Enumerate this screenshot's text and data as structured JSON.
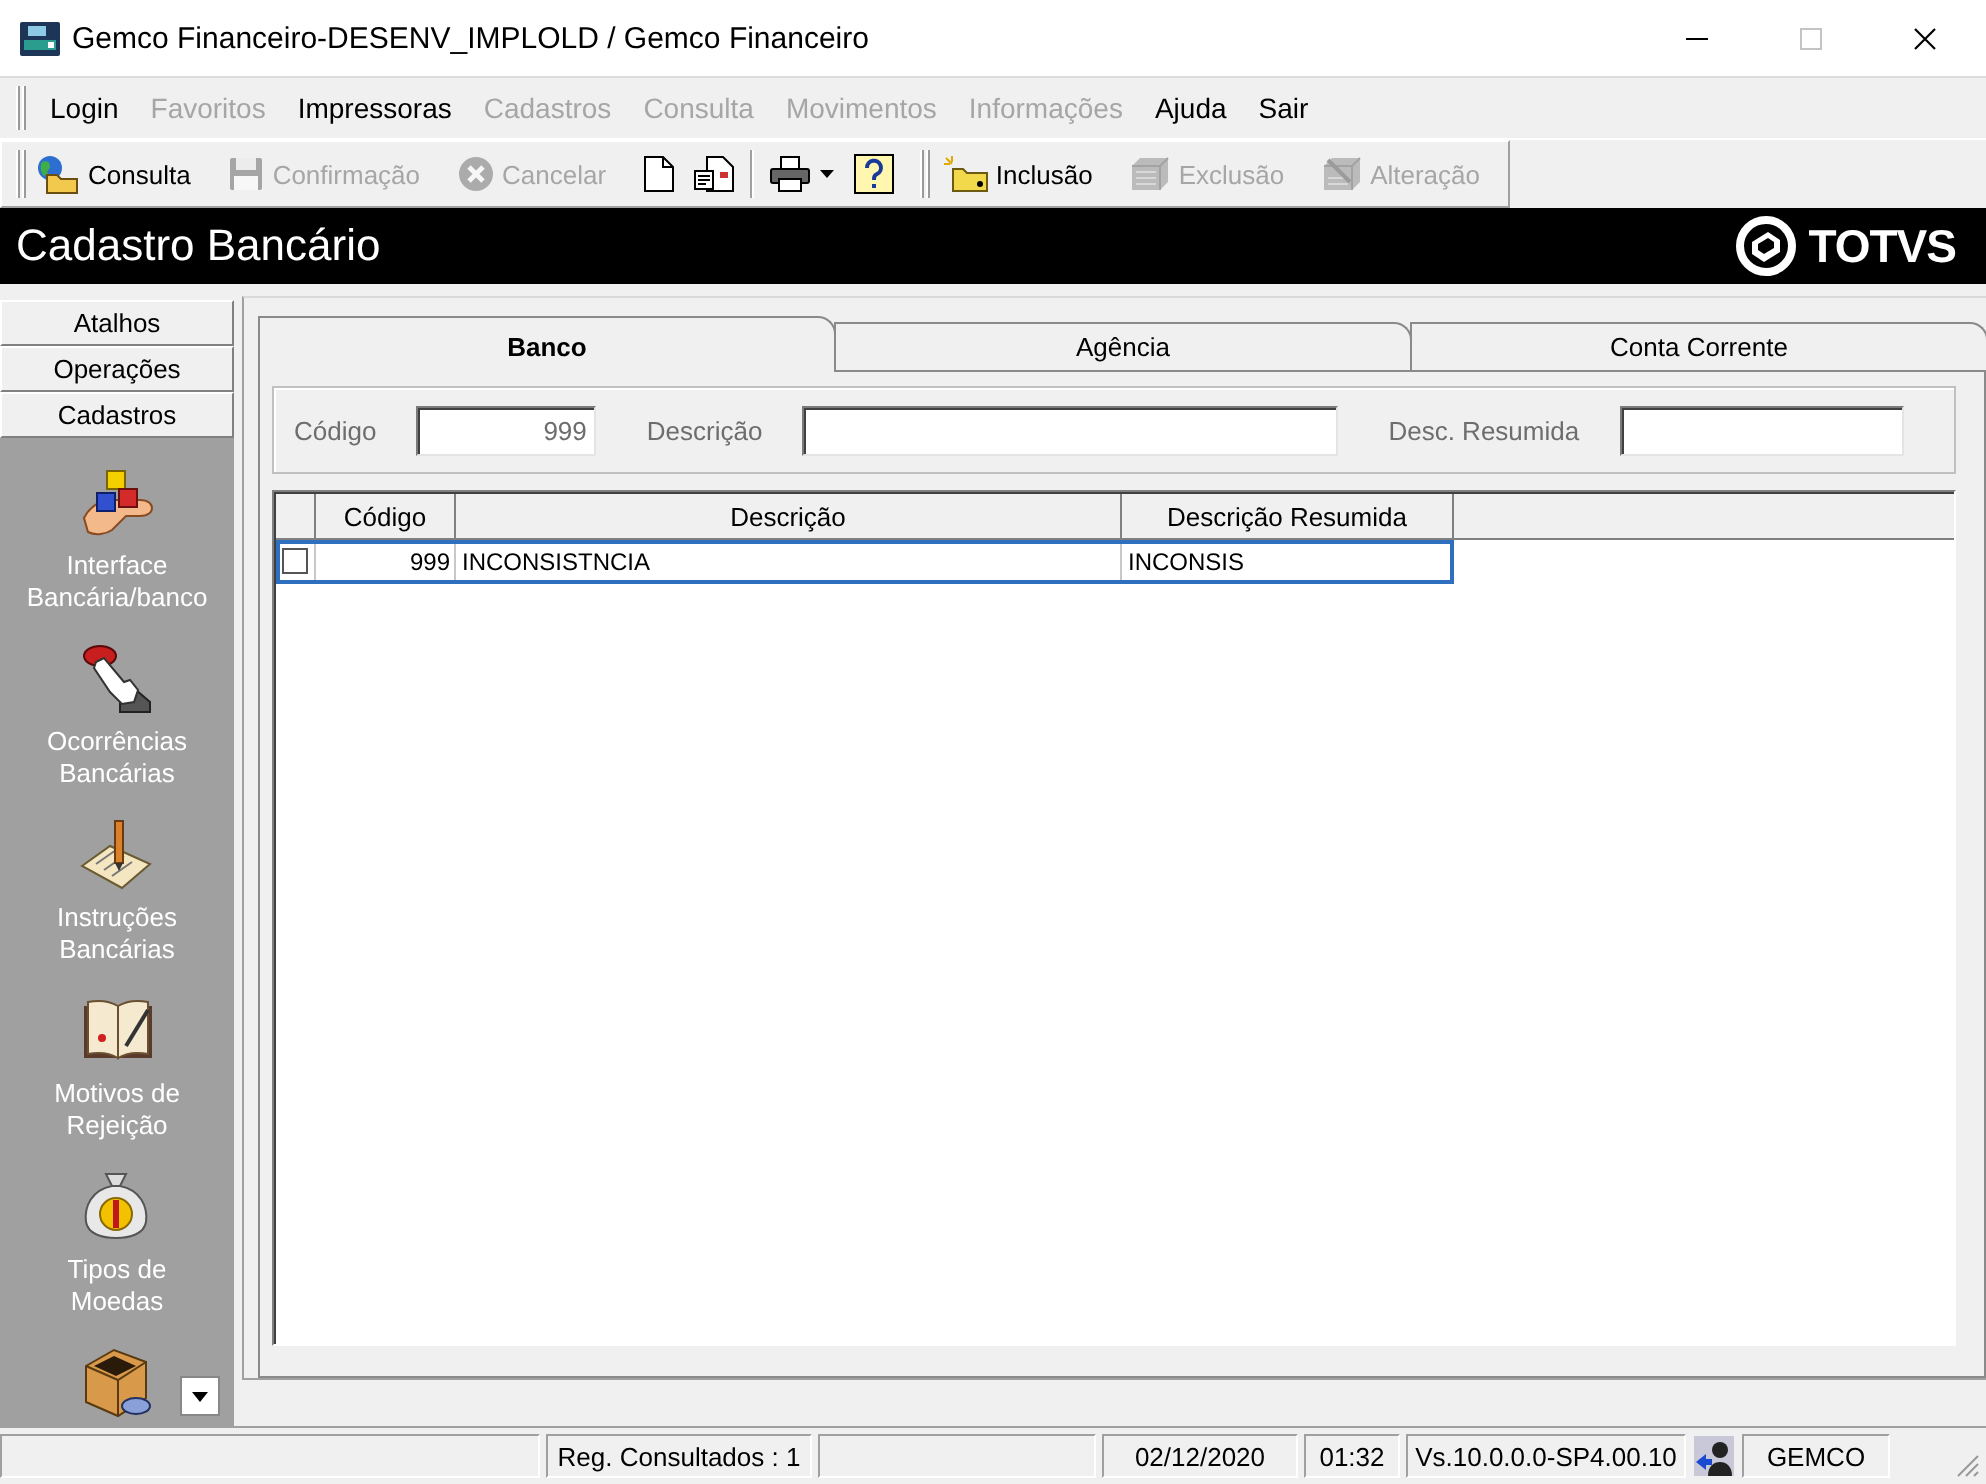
{
  "window": {
    "title": "Gemco Financeiro-DESENV_IMPLOLD / Gemco Financeiro",
    "controls": [
      {
        "kind": "minimize",
        "disabled": false
      },
      {
        "kind": "maximize",
        "disabled": true
      },
      {
        "kind": "close",
        "disabled": false
      }
    ]
  },
  "menu": [
    {
      "label": "Login",
      "disabled": false
    },
    {
      "label": "Favoritos",
      "disabled": true
    },
    {
      "label": "Impressoras",
      "disabled": false
    },
    {
      "label": "Cadastros",
      "disabled": true
    },
    {
      "label": "Consulta",
      "disabled": true
    },
    {
      "label": "Movimentos",
      "disabled": true
    },
    {
      "label": "Informações",
      "disabled": true
    },
    {
      "label": "Ajuda",
      "disabled": false
    },
    {
      "label": "Sair",
      "disabled": false
    }
  ],
  "toolbar": {
    "groups": [
      {
        "items": [
          {
            "kind": "labeled",
            "label": "Consulta",
            "disabled": false
          },
          {
            "kind": "labeled",
            "label": "Confirmação",
            "disabled": true
          },
          {
            "kind": "labeled",
            "label": "Cancelar",
            "disabled": true
          },
          {
            "kind": "icon",
            "disabled": false
          },
          {
            "kind": "icon",
            "disabled": false
          }
        ]
      },
      {
        "items": [
          {
            "kind": "dropdown",
            "disabled": false
          },
          {
            "kind": "icon",
            "disabled": false
          }
        ]
      },
      {
        "items": [
          {
            "kind": "labeled",
            "label": "Inclusão",
            "disabled": false
          },
          {
            "kind": "labeled",
            "label": "Exclusão",
            "disabled": true
          },
          {
            "kind": "labeled",
            "label": "Alteração",
            "disabled": true
          }
        ]
      }
    ]
  },
  "header": {
    "title": "Cadastro Bancário",
    "logo": "TOTVS"
  },
  "sidebar": {
    "sections": [
      {
        "label": "Atalhos"
      },
      {
        "label": "Operações"
      },
      {
        "label": "Cadastros",
        "items": [
          {
            "kind": "launcher",
            "label": "Interface\nBancária/banco"
          },
          {
            "kind": "launcher",
            "label": "Ocorrências\nBancárias"
          },
          {
            "kind": "launcher",
            "label": "Instruções\nBancárias"
          },
          {
            "kind": "launcher",
            "label": "Motivos de\nRejeição"
          },
          {
            "kind": "launcher",
            "label": "Tipos de\nMoedas"
          },
          {
            "kind": "cut_off"
          }
        ]
      }
    ]
  },
  "tabs": [
    {
      "label": "Banco",
      "selected": true
    },
    {
      "label": "Agência",
      "selected": false
    },
    {
      "label": "Conta Corrente",
      "selected": false
    }
  ],
  "filter": {
    "fields": [
      {
        "label": "Código",
        "kind": "numeric",
        "value": "999",
        "disabled": true
      },
      {
        "label": "Descrição",
        "kind": "text",
        "disabled": true
      },
      {
        "label": "Desc. Resumida",
        "kind": "text",
        "disabled": true
      }
    ]
  },
  "grid": {
    "columns": [
      {
        "label": "Código",
        "kind": "numeric"
      },
      {
        "label": "Descrição",
        "kind": "text"
      },
      {
        "label": "Descrição Resumida",
        "kind": "text"
      }
    ],
    "rows": [
      {
        "checked": false,
        "selected": true,
        "cells": [
          "999",
          "INCONSISTNCIA",
          "INCONSIS"
        ]
      }
    ]
  },
  "status_bar": {
    "panels": [
      {
        "kind": "empty"
      },
      {
        "kind": "text",
        "text": "Reg. Consultados : 1"
      },
      {
        "kind": "empty"
      },
      {
        "kind": "text",
        "text": "02/12/2020"
      },
      {
        "kind": "text",
        "text": "01:32"
      },
      {
        "kind": "text",
        "text": "Vs.10.0.0.0-SP4.00.10"
      },
      {
        "kind": "icon"
      },
      {
        "kind": "text",
        "text": "GEMCO"
      }
    ]
  }
}
